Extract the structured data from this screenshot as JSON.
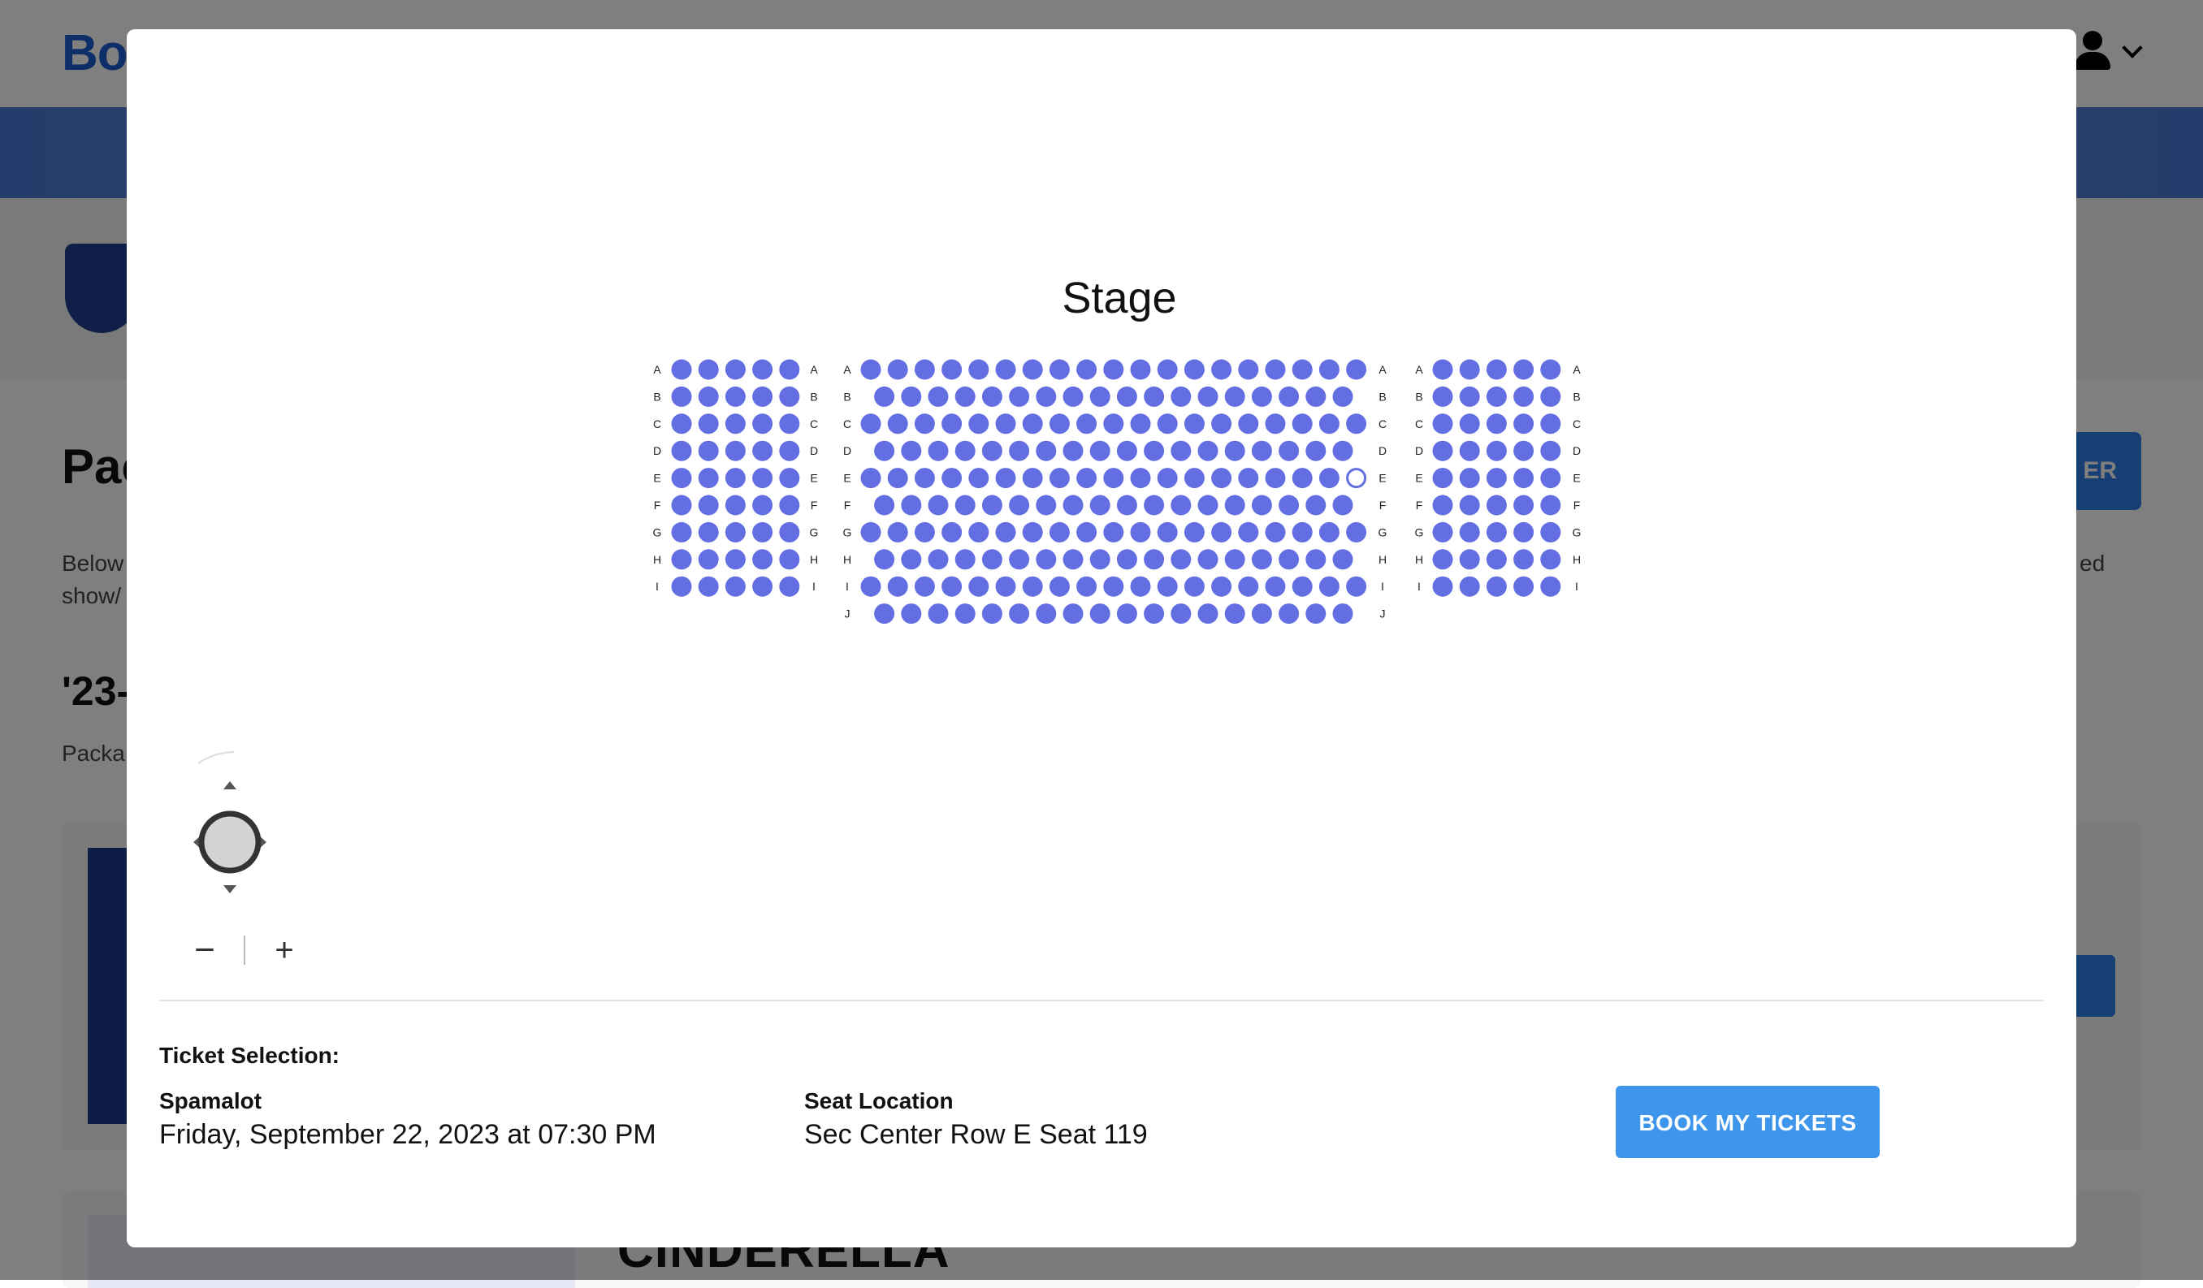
{
  "background": {
    "logo": "Boo",
    "heading": "Pac",
    "intro_line1": "Below",
    "intro_line2": "show/",
    "season": "'23-",
    "package_label": "Packa",
    "side_button": "ER",
    "side_text": "ed",
    "card_title": "CINDERELLA"
  },
  "seat_map": {
    "stage_label": "Stage",
    "sections": [
      {
        "name": "Left",
        "rows": [
          {
            "label": "A",
            "seats": 5,
            "offset": 0
          },
          {
            "label": "B",
            "seats": 5,
            "offset": 0
          },
          {
            "label": "C",
            "seats": 5,
            "offset": 0
          },
          {
            "label": "D",
            "seats": 5,
            "offset": 0
          },
          {
            "label": "E",
            "seats": 5,
            "offset": 0
          },
          {
            "label": "F",
            "seats": 5,
            "offset": 0
          },
          {
            "label": "G",
            "seats": 5,
            "offset": 0
          },
          {
            "label": "H",
            "seats": 5,
            "offset": 0
          },
          {
            "label": "I",
            "seats": 5,
            "offset": 0
          }
        ]
      },
      {
        "name": "Center",
        "rows": [
          {
            "label": "A",
            "seats": 19,
            "offset": 0
          },
          {
            "label": "B",
            "seats": 18,
            "offset": 0.5
          },
          {
            "label": "C",
            "seats": 19,
            "offset": 0
          },
          {
            "label": "D",
            "seats": 18,
            "offset": 0.5
          },
          {
            "label": "E",
            "seats": 19,
            "offset": 0,
            "selected_index": 18
          },
          {
            "label": "F",
            "seats": 18,
            "offset": 0.5
          },
          {
            "label": "G",
            "seats": 19,
            "offset": 0
          },
          {
            "label": "H",
            "seats": 18,
            "offset": 0.5
          },
          {
            "label": "I",
            "seats": 19,
            "offset": 0
          },
          {
            "label": "J",
            "seats": 18,
            "offset": 0.5
          }
        ]
      },
      {
        "name": "Right",
        "rows": [
          {
            "label": "A",
            "seats": 5,
            "offset": 0
          },
          {
            "label": "B",
            "seats": 5,
            "offset": 0
          },
          {
            "label": "C",
            "seats": 5,
            "offset": 0
          },
          {
            "label": "D",
            "seats": 5,
            "offset": 0
          },
          {
            "label": "E",
            "seats": 5,
            "offset": 0
          },
          {
            "label": "F",
            "seats": 5,
            "offset": 0
          },
          {
            "label": "G",
            "seats": 5,
            "offset": 0
          },
          {
            "label": "H",
            "seats": 5,
            "offset": 0
          },
          {
            "label": "I",
            "seats": 5,
            "offset": 0
          }
        ]
      }
    ],
    "seat_color": "#636ee2"
  },
  "controls": {
    "zoom_out": "−",
    "zoom_in": "+"
  },
  "ticket_selection": {
    "heading": "Ticket Selection:",
    "show_name": "Spamalot",
    "show_datetime": "Friday, September 22, 2023 at 07:30 PM",
    "location_label": "Seat Location",
    "location_value": "Sec Center Row E Seat 119",
    "book_button": "BOOK MY TICKETS"
  }
}
